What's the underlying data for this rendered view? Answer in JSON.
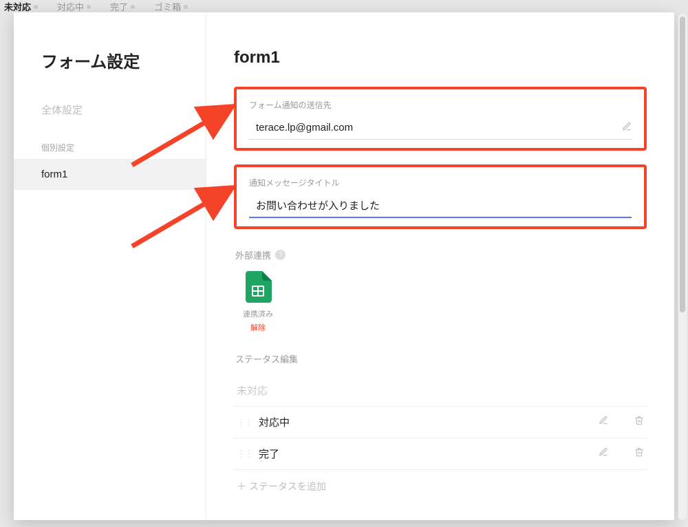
{
  "tabs": {
    "items": [
      "未対応",
      "対応中",
      "完了",
      "ゴミ箱"
    ],
    "active_index": 0
  },
  "sidebar": {
    "title": "フォーム設定",
    "global_link": "全体設定",
    "section_label": "個別設定",
    "selected_item": "form1"
  },
  "main": {
    "title": "form1",
    "field1": {
      "label": "フォーム通知の送信先",
      "value": "terace.lp@gmail.com"
    },
    "field2": {
      "label": "通知メッセージタイトル",
      "value": "お問い合わせが入りました"
    },
    "integration": {
      "section_label": "外部連携",
      "status": "連携済み",
      "unlink": "解除"
    },
    "status_edit": {
      "label": "ステータス編集",
      "placeholder": "未対応",
      "items": [
        "対応中",
        "完了"
      ],
      "add_label": "＋ ステータスを追加"
    }
  }
}
